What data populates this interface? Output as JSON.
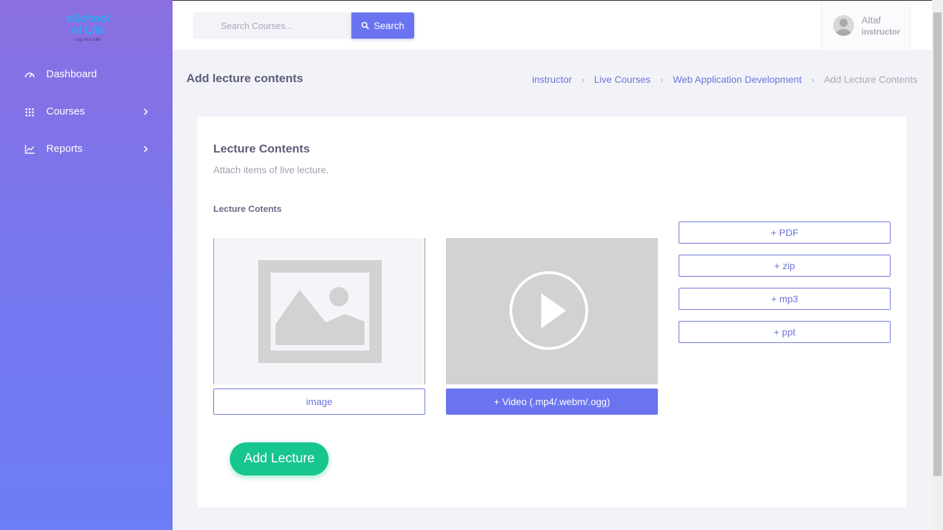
{
  "brand": {
    "line1": "eSchool",
    "line2": "of Life",
    "tagline": "Log on to Life"
  },
  "sidebar": {
    "items": [
      {
        "label": "Dashboard",
        "icon": "speedometer-icon"
      },
      {
        "label": "Courses",
        "icon": "grid-icon"
      },
      {
        "label": "Reports",
        "icon": "line-chart-icon"
      }
    ]
  },
  "search": {
    "placeholder": "Search Courses...",
    "button_label": "Search"
  },
  "user": {
    "name": "Altaf",
    "role": "instructor"
  },
  "page": {
    "title": "Add lecture contents"
  },
  "breadcrumb": [
    "instructor",
    "Live Courses",
    "Web Application Development",
    "Add Lecture Contents"
  ],
  "card": {
    "title": "Lecture Contents",
    "subtitle": "Attach items of live lecture.",
    "section_label": "Lecture Cotents",
    "image_button": "image",
    "video_button": "+ Video (.mp4/.webm/.ogg)",
    "file_buttons": [
      "+ PDF",
      "+ zip",
      "+ mp3",
      "+ ppt"
    ],
    "submit_button": "Add Lecture"
  },
  "colors": {
    "accent": "#6b74f0",
    "success": "#17c58e",
    "sidebar_top": "#8b6fe0",
    "sidebar_bottom": "#6d7df5"
  }
}
